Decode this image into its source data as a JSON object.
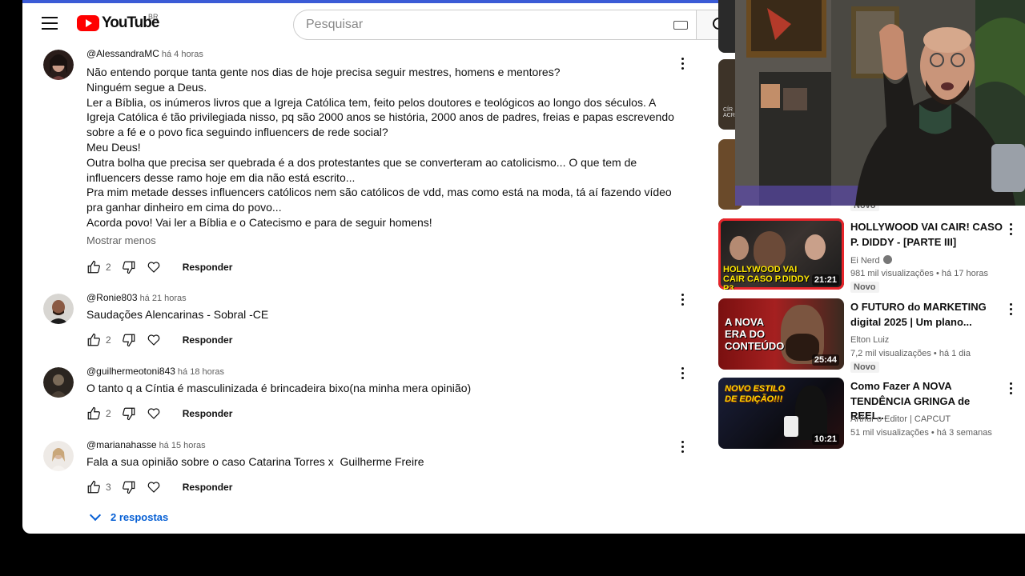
{
  "header": {
    "brand": "YouTube",
    "country_code": "BR",
    "search_placeholder": "Pesquisar"
  },
  "comments": [
    {
      "author": "@AlessandraMC",
      "time": "há 4 horas",
      "text": "Não entendo porque tanta gente nos dias de hoje precisa seguir mestres, homens e mentores?\nNinguém segue a Deus.\nLer a Bíblia, os inúmeros livros que a Igreja Católica tem, feito pelos doutores e teológicos ao longo dos séculos. A Igreja Católica é tão privilegiada nisso, pq são 2000 anos se história, 2000 anos de padres, freias e papas escrevendo sobre a fé e o povo fica seguindo influencers de rede social?\nMeu Deus!\nOutra bolha que precisa ser quebrada é a dos protestantes que se converteram ao catolicismo... O que tem de influencers desse ramo hoje em dia não está escrito...\nPra mim metade desses influencers católicos nem são católicos de vdd, mas como está na moda, tá aí fazendo vídeo pra ganhar dinheiro em cima do povo...\nAcorda povo! Vai ler a Bíblia e o Catecismo e para de seguir homens!",
      "show_less": "Mostrar menos",
      "likes": "2",
      "reply_label": "Responder"
    },
    {
      "author": "@Ronie803",
      "time": "há 21 horas",
      "text": "Saudações Alencarinas - Sobral -CE",
      "likes": "2",
      "reply_label": "Responder"
    },
    {
      "author": "@guilhermeotoni843",
      "time": "há 18 horas",
      "text": "O tanto q a Cíntia é masculinizada é brincadeira bixo(na minha mera opinião)",
      "likes": "2",
      "reply_label": "Responder"
    },
    {
      "author": "@marianahasse",
      "time": "há 15 horas",
      "text": "Fala a sua opinião sobre o caso Catarina Torres x  Guilherme Freire",
      "likes": "3",
      "reply_label": "Responder",
      "replies_label": "2 respostas"
    }
  ],
  "recommended": [
    {
      "title": "HOLLYWOOD VAI CAIR! CASO P. DIDDY - [PARTE III]",
      "channel": "Ei Nerd",
      "views": "981 mil visualizações",
      "age": "há 17 horas",
      "badge": "Novo",
      "duration": "21:21",
      "thumb_text": "HOLLYWOOD VAI CAIR CASO P.DIDDY P3"
    },
    {
      "title": "O FUTURO do MARKETING digital 2025 | Um plano...",
      "channel": "Elton Luiz",
      "views": "7,2 mil visualizações",
      "age": "há 1 dia",
      "badge": "Novo",
      "duration": "25:44",
      "thumb_text": "A NOVA ERA DO CONTEÚDO"
    },
    {
      "title": "Como Fazer A NOVA TENDÊNCIA GRINGA de REEL...",
      "channel": "Arthur o Editor | CAPCUT",
      "views": "51 mil visualizações",
      "age": "há 3 semanas",
      "duration": "10:21",
      "thumb_text": "NOVO ESTILO DE EDIÇÃO!!!"
    }
  ],
  "partial_badge": "Novo",
  "partial_thumb_text": "CÍR ACR"
}
